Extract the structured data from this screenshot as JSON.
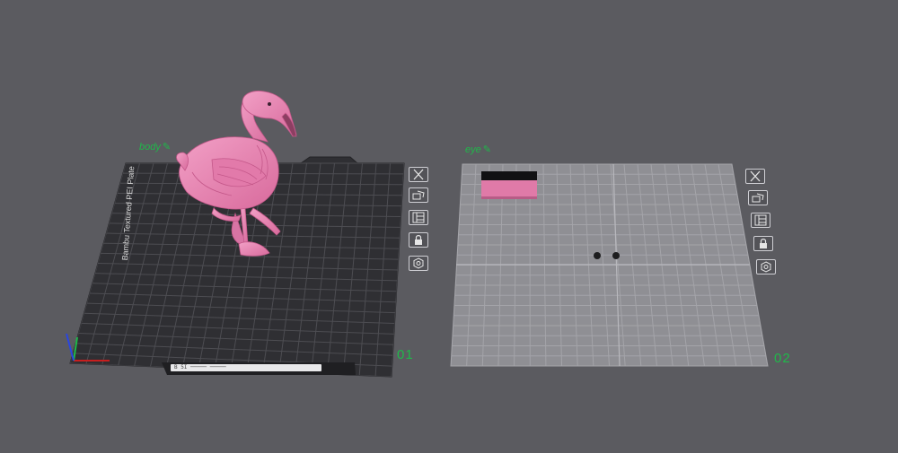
{
  "plates": [
    {
      "name": "body",
      "index": "01",
      "bed_label": "Bambu Textured PEI Plate",
      "status_text": "B 5I ───── ─────",
      "buttons": [
        "close-icon",
        "arrange-icon",
        "layout-icon",
        "lock-icon",
        "settings-icon"
      ]
    },
    {
      "name": "eye",
      "index": "02",
      "buttons": [
        "close-icon",
        "arrange-icon",
        "layout-icon",
        "lock-icon",
        "settings-icon"
      ]
    }
  ],
  "edit_glyph": "✎",
  "colors": {
    "background": "#5b5b60",
    "plate1": "#2f2f33",
    "plate2": "#8f8f94",
    "accent": "#1fb84a",
    "flamingo": "#ea84b2",
    "axis_x": "#c81e1e",
    "axis_y": "#1fb84a",
    "axis_z": "#2a46e0"
  }
}
